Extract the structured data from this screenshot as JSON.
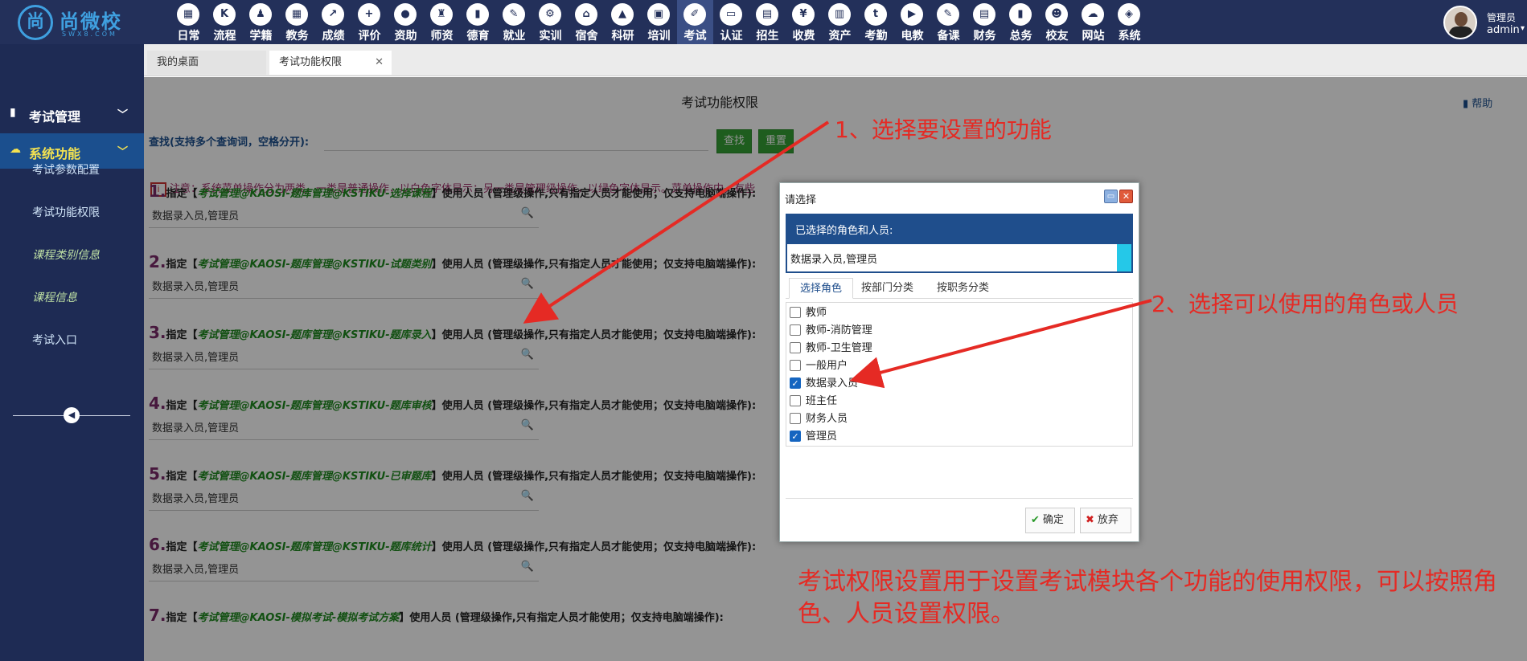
{
  "brand": {
    "logo_mark": "尚",
    "logo_text": "尚微校",
    "logo_sub": "SWX8.COM"
  },
  "top_nav": [
    {
      "label": "日常",
      "icon": "calendar-icon",
      "glyph": "▦"
    },
    {
      "label": "流程",
      "icon": "flow-icon",
      "glyph": "K"
    },
    {
      "label": "学籍",
      "icon": "student-icon",
      "glyph": "♟"
    },
    {
      "label": "教务",
      "icon": "schedule-icon",
      "glyph": "▦"
    },
    {
      "label": "成绩",
      "icon": "chart-icon",
      "glyph": "↗"
    },
    {
      "label": "评价",
      "icon": "evaluate-icon",
      "glyph": "+"
    },
    {
      "label": "资助",
      "icon": "aid-icon",
      "glyph": "●"
    },
    {
      "label": "师资",
      "icon": "teacher-icon",
      "glyph": "♜"
    },
    {
      "label": "德育",
      "icon": "book-icon",
      "glyph": "▮"
    },
    {
      "label": "就业",
      "icon": "hammer-icon",
      "glyph": "✎"
    },
    {
      "label": "实训",
      "icon": "training-icon",
      "glyph": "⚙"
    },
    {
      "label": "宿舍",
      "icon": "home-icon",
      "glyph": "⌂"
    },
    {
      "label": "科研",
      "icon": "graduation-icon",
      "glyph": "▲"
    },
    {
      "label": "培训",
      "icon": "image-icon",
      "glyph": "▣"
    },
    {
      "label": "考试",
      "icon": "wrench-icon",
      "glyph": "✐",
      "active": true
    },
    {
      "label": "认证",
      "icon": "monitor-icon",
      "glyph": "▭"
    },
    {
      "label": "招生",
      "icon": "bus-icon",
      "glyph": "▤"
    },
    {
      "label": "收费",
      "icon": "yen-icon",
      "glyph": "¥"
    },
    {
      "label": "资产",
      "icon": "train-icon",
      "glyph": "▥"
    },
    {
      "label": "考勤",
      "icon": "attendance-icon",
      "glyph": "t"
    },
    {
      "label": "电教",
      "icon": "media-icon",
      "glyph": "▶"
    },
    {
      "label": "备课",
      "icon": "edit-icon",
      "glyph": "✎"
    },
    {
      "label": "财务",
      "icon": "news-icon",
      "glyph": "▤"
    },
    {
      "label": "总务",
      "icon": "signal-icon",
      "glyph": "▮"
    },
    {
      "label": "校友",
      "icon": "users-icon",
      "glyph": "☻"
    },
    {
      "label": "网站",
      "icon": "cloud-icon",
      "glyph": "☁"
    },
    {
      "label": "系统",
      "icon": "cube-icon",
      "glyph": "◈"
    }
  ],
  "user": {
    "role": "管理员",
    "name": "admin"
  },
  "sidebar": {
    "groups": [
      {
        "label": "考试管理",
        "icon": "book-icon"
      },
      {
        "label": "系统功能",
        "icon": "cloud-icon"
      }
    ],
    "items": [
      {
        "label": "考试参数配置"
      },
      {
        "label": "考试功能权限"
      },
      {
        "label": "课程类别信息"
      },
      {
        "label": "课程信息"
      },
      {
        "label": "考试入口"
      }
    ]
  },
  "tabs": [
    {
      "label": "我的桌面"
    },
    {
      "label": "考试功能权限"
    }
  ],
  "page": {
    "title": "考试功能权限",
    "help": "帮助",
    "search_label": "查找(支持多个查询词，空格分开):",
    "search_value": "",
    "find_btn": "查找",
    "reset_btn": "重置",
    "notice": "注意：系统菜单操作分为两类，一类是普通操作，以白色字体显示；另一类是管理级操作，以绿色字体显示。菜单操作中，有些"
  },
  "permissions": [
    {
      "num": "1.",
      "pre": "指定【",
      "func": "考试管理@KAOSI-题库管理@KSTIKU-选择课程",
      "post": "】使用人员 (管理级操作,只有指定人员才能使用；仅支持电脑端操作):",
      "value": "数据录入员,管理员"
    },
    {
      "num": "2.",
      "pre": "指定【",
      "func": "考试管理@KAOSI-题库管理@KSTIKU-试题类别",
      "post": "】使用人员 (管理级操作,只有指定人员才能使用；仅支持电脑端操作):",
      "value": "数据录入员,管理员"
    },
    {
      "num": "3.",
      "pre": "指定【",
      "func": "考试管理@KAOSI-题库管理@KSTIKU-题库录入",
      "post": "】使用人员 (管理级操作,只有指定人员才能使用；仅支持电脑端操作):",
      "value": "数据录入员,管理员"
    },
    {
      "num": "4.",
      "pre": "指定【",
      "func": "考试管理@KAOSI-题库管理@KSTIKU-题库审核",
      "post": "】使用人员 (管理级操作,只有指定人员才能使用；仅支持电脑端操作):",
      "value": "数据录入员,管理员"
    },
    {
      "num": "5.",
      "pre": "指定【",
      "func": "考试管理@KAOSI-题库管理@KSTIKU-已审题库",
      "post": "】使用人员 (管理级操作,只有指定人员才能使用；仅支持电脑端操作):",
      "value": "数据录入员,管理员"
    },
    {
      "num": "6.",
      "pre": "指定【",
      "func": "考试管理@KAOSI-题库管理@KSTIKU-题库统计",
      "post": "】使用人员 (管理级操作,只有指定人员才能使用；仅支持电脑端操作):",
      "value": "数据录入员,管理员"
    },
    {
      "num": "7.",
      "pre": "指定【",
      "func": "考试管理@KAOSI-模拟考试-模拟考试方案",
      "post": "】使用人员 (管理级操作,只有指定人员才能使用；仅支持电脑端操作):",
      "value": ""
    }
  ],
  "dialog": {
    "title": "请选择",
    "selected_header": "已选择的角色和人员:",
    "selected_value": "数据录入员,管理员",
    "tabs": [
      {
        "label": "选择角色"
      },
      {
        "label": "按部门分类"
      },
      {
        "label": "按职务分类"
      }
    ],
    "roles": [
      {
        "label": "教师",
        "checked": false
      },
      {
        "label": "教师-消防管理",
        "checked": false
      },
      {
        "label": "教师-卫生管理",
        "checked": false
      },
      {
        "label": "一般用户",
        "checked": false
      },
      {
        "label": "数据录入员",
        "checked": true
      },
      {
        "label": "班主任",
        "checked": false
      },
      {
        "label": "财务人员",
        "checked": false
      },
      {
        "label": "管理员",
        "checked": true
      }
    ],
    "ok": "确定",
    "cancel": "放弃"
  },
  "annotations": {
    "step1": "1、选择要设置的功能",
    "step2": "2、选择可以使用的角色或人员",
    "summary": "考试权限设置用于设置考试模块各个功能的使用权限，可以按照角色、人员设置权限。"
  },
  "colors": {
    "topbar": "#23305a",
    "sidebar": "#1e2b54",
    "accent": "#1f4e8c",
    "annotation": "#e52a24",
    "button_green": "#35a035"
  }
}
